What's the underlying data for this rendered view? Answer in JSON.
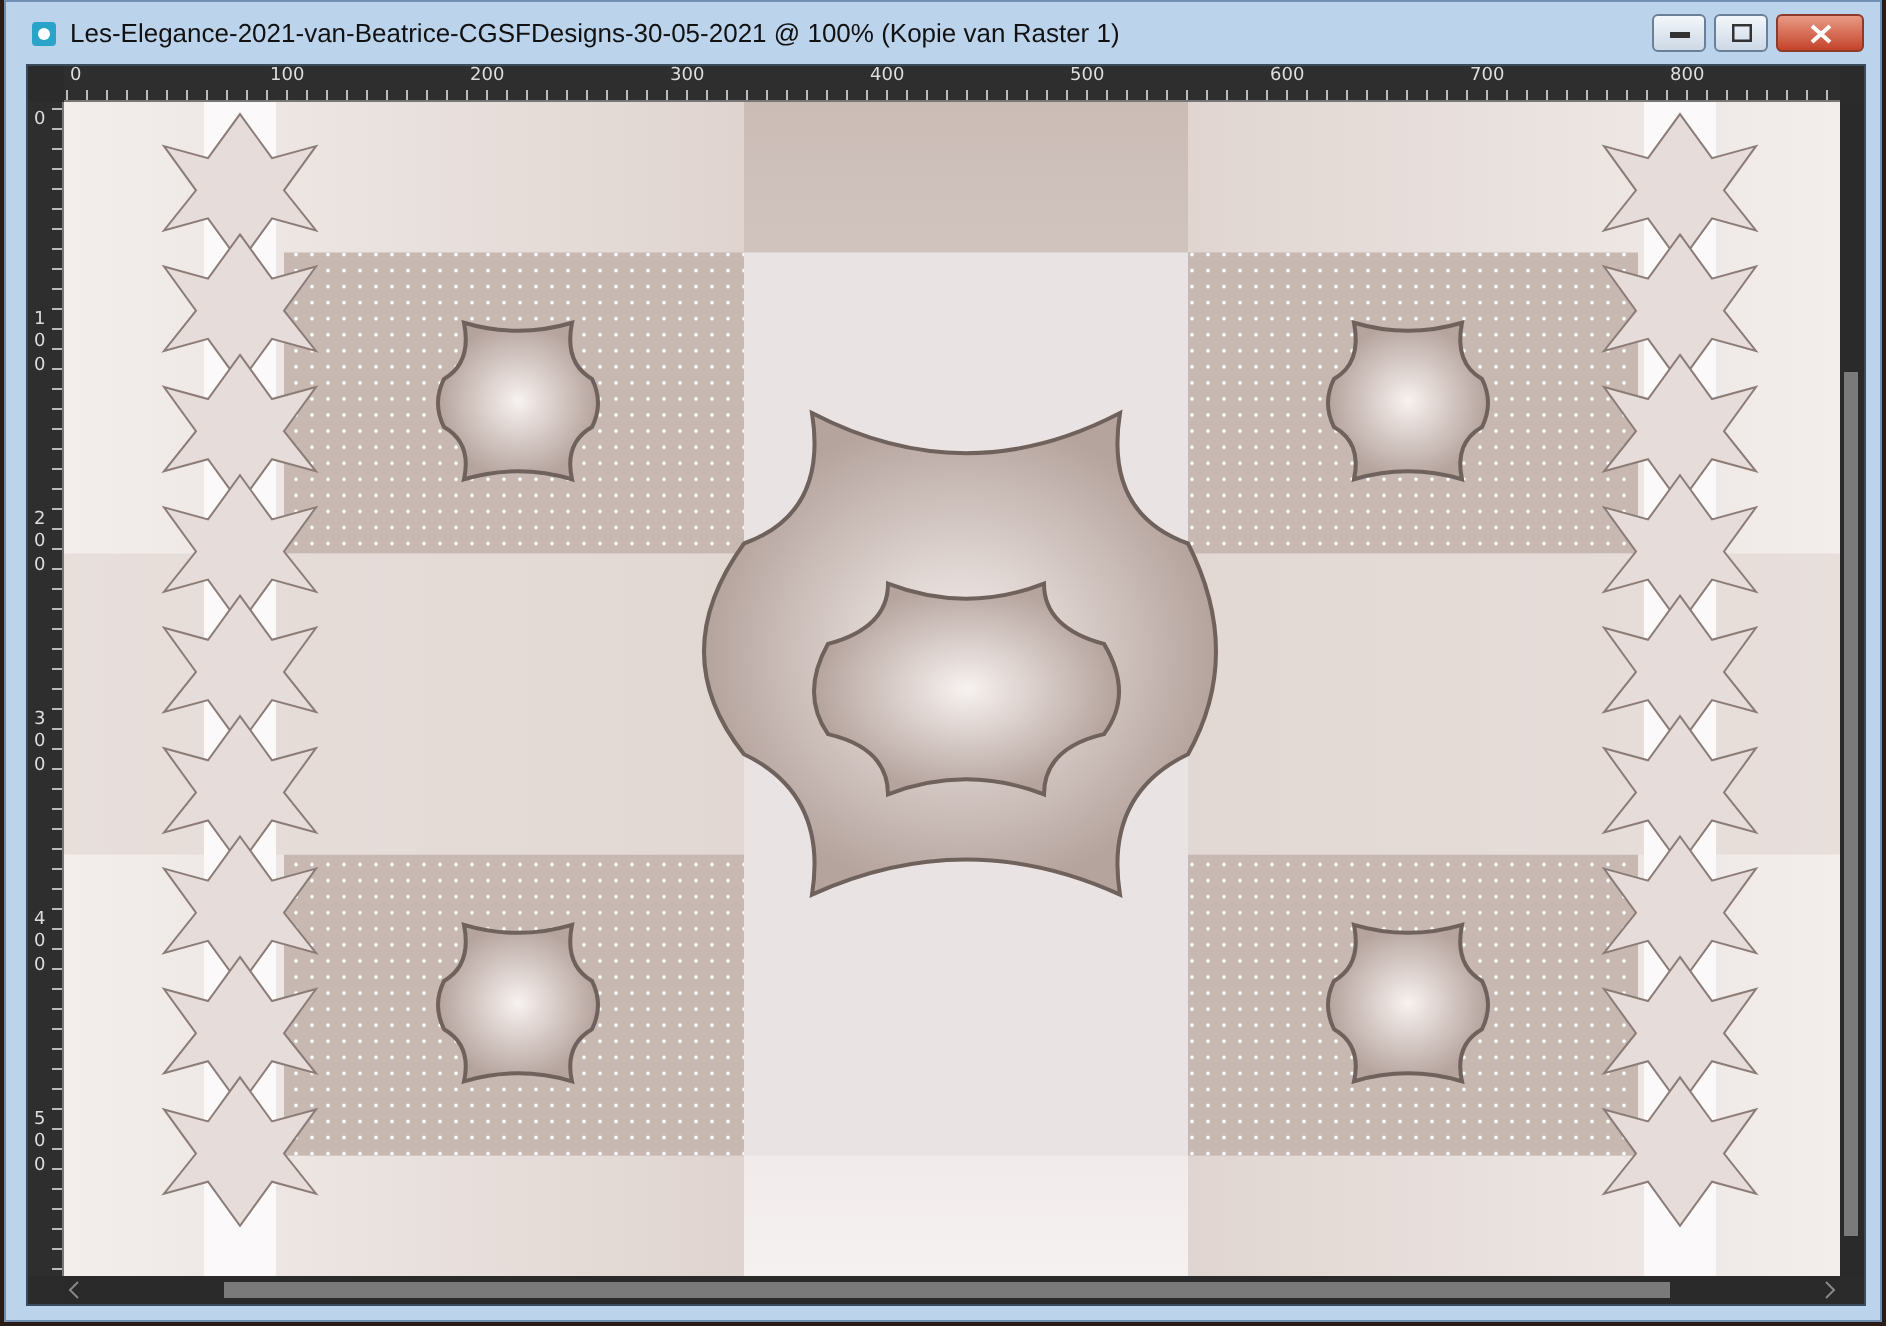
{
  "window": {
    "title": "Les-Elegance-2021-van-Beatrice-CGSFDesigns-30-05-2021 @ 100% (Kopie van Raster 1)"
  },
  "horizontal_ruler": {
    "labels": [
      "0",
      "100",
      "200",
      "300",
      "400",
      "500",
      "600",
      "700",
      "800"
    ]
  },
  "vertical_ruler": {
    "labels": [
      "0",
      "100",
      "200",
      "300",
      "400",
      "500"
    ]
  }
}
